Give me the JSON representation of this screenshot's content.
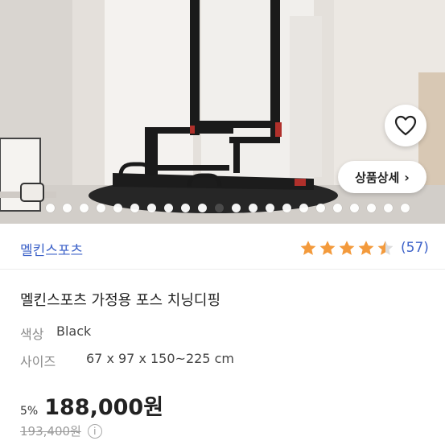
{
  "hero": {
    "detail_label": "상품상세",
    "detail_chevron": "›",
    "favorite_icon": "heart-icon",
    "slide_count": 22,
    "active_slide": 10
  },
  "product": {
    "brand": "멜킨스포츠",
    "rating": 4.5,
    "review_count": "(57)",
    "title": "멜킨스포츠 가정용 포스 치닝디핑",
    "options": [
      {
        "key": "색상",
        "value": "Black"
      },
      {
        "key": "사이즈",
        "value": "67 x 97 x 150~225 cm"
      }
    ],
    "discount": "5%",
    "price": "188,000원",
    "original_price": "193,400원",
    "info_icon": "i"
  },
  "colors": {
    "accent": "#3e63c9",
    "star": "#f39a3c",
    "star_empty": "#dcdcdc"
  }
}
